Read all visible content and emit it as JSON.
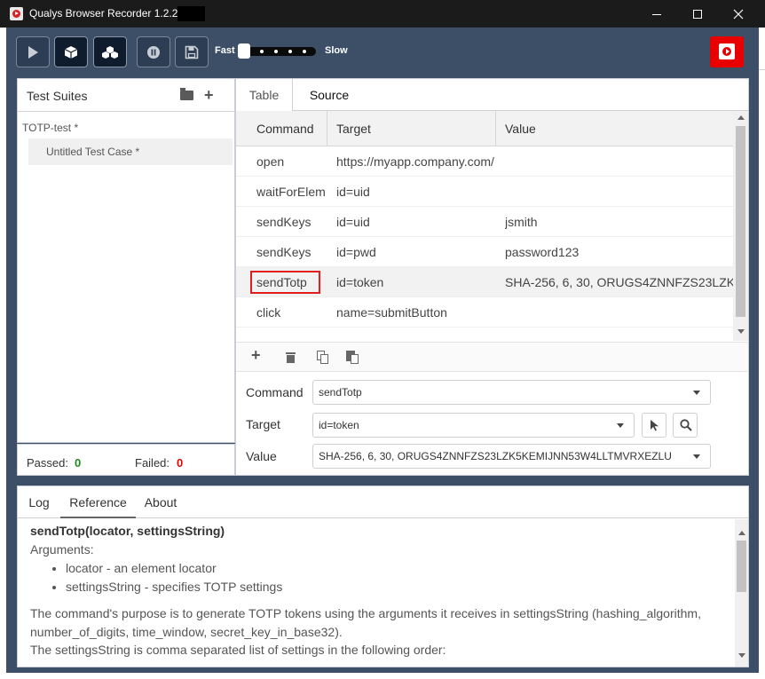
{
  "window": {
    "title": "Qualys Browser Recorder 1.2.20"
  },
  "toolbar": {
    "buttons": [
      {
        "name": "play-icon"
      },
      {
        "name": "cube-icon"
      },
      {
        "name": "cubes-icon"
      },
      {
        "name": "pause-icon"
      },
      {
        "name": "save-icon"
      }
    ],
    "speed_fast": "Fast",
    "speed_slow": "Slow",
    "record_color": "#e80000"
  },
  "left_panel": {
    "header": "Test Suites",
    "suite_name": "TOTP-test *",
    "case_name": "Untitled Test Case *"
  },
  "stats": {
    "passed_label": "Passed:",
    "passed_value": "0",
    "failed_label": "Failed:",
    "failed_value": "0"
  },
  "editor": {
    "tabs": [
      "Table",
      "Source"
    ],
    "columns": [
      "Command",
      "Target",
      "Value"
    ],
    "rows": [
      {
        "command": "open",
        "target": "https://myapp.company.com/",
        "value": ""
      },
      {
        "command": "waitForElem",
        "target": "id=uid",
        "value": ""
      },
      {
        "command": "sendKeys",
        "target": "id=uid",
        "value": "jsmith"
      },
      {
        "command": "sendKeys",
        "target": "id=pwd",
        "value": "password123"
      },
      {
        "command": "sendTotp",
        "target": "id=token",
        "value": "SHA-256, 6, 30, ORUGS4ZNNFZS23LZK"
      },
      {
        "command": "click",
        "target": "name=submitButton",
        "value": ""
      }
    ],
    "selected_row": 4
  },
  "form": {
    "command_label": "Command",
    "command_value": "sendTotp",
    "target_label": "Target",
    "target_value": "id=token",
    "value_label": "Value",
    "value_value": "SHA-256, 6, 30, ORUGS4ZNNFZS23LZK5KEMIJNN53W4LLTMVRXEZLU"
  },
  "bottom": {
    "tabs": [
      "Log",
      "Reference",
      "About"
    ],
    "active_tab": "Reference",
    "signature": "sendTotp(locator, settingsString)",
    "arguments_label": "Arguments:",
    "args": [
      "locator - an element locator",
      "settingsString - specifies TOTP settings"
    ],
    "para1": "The command's purpose is to generate TOTP tokens using the arguments it receives in settingsString (hashing_algorithm, number_of_digits, time_window, secret_key_in_base32).",
    "para2": "The settingsString is comma separated list of settings in the following order:"
  }
}
